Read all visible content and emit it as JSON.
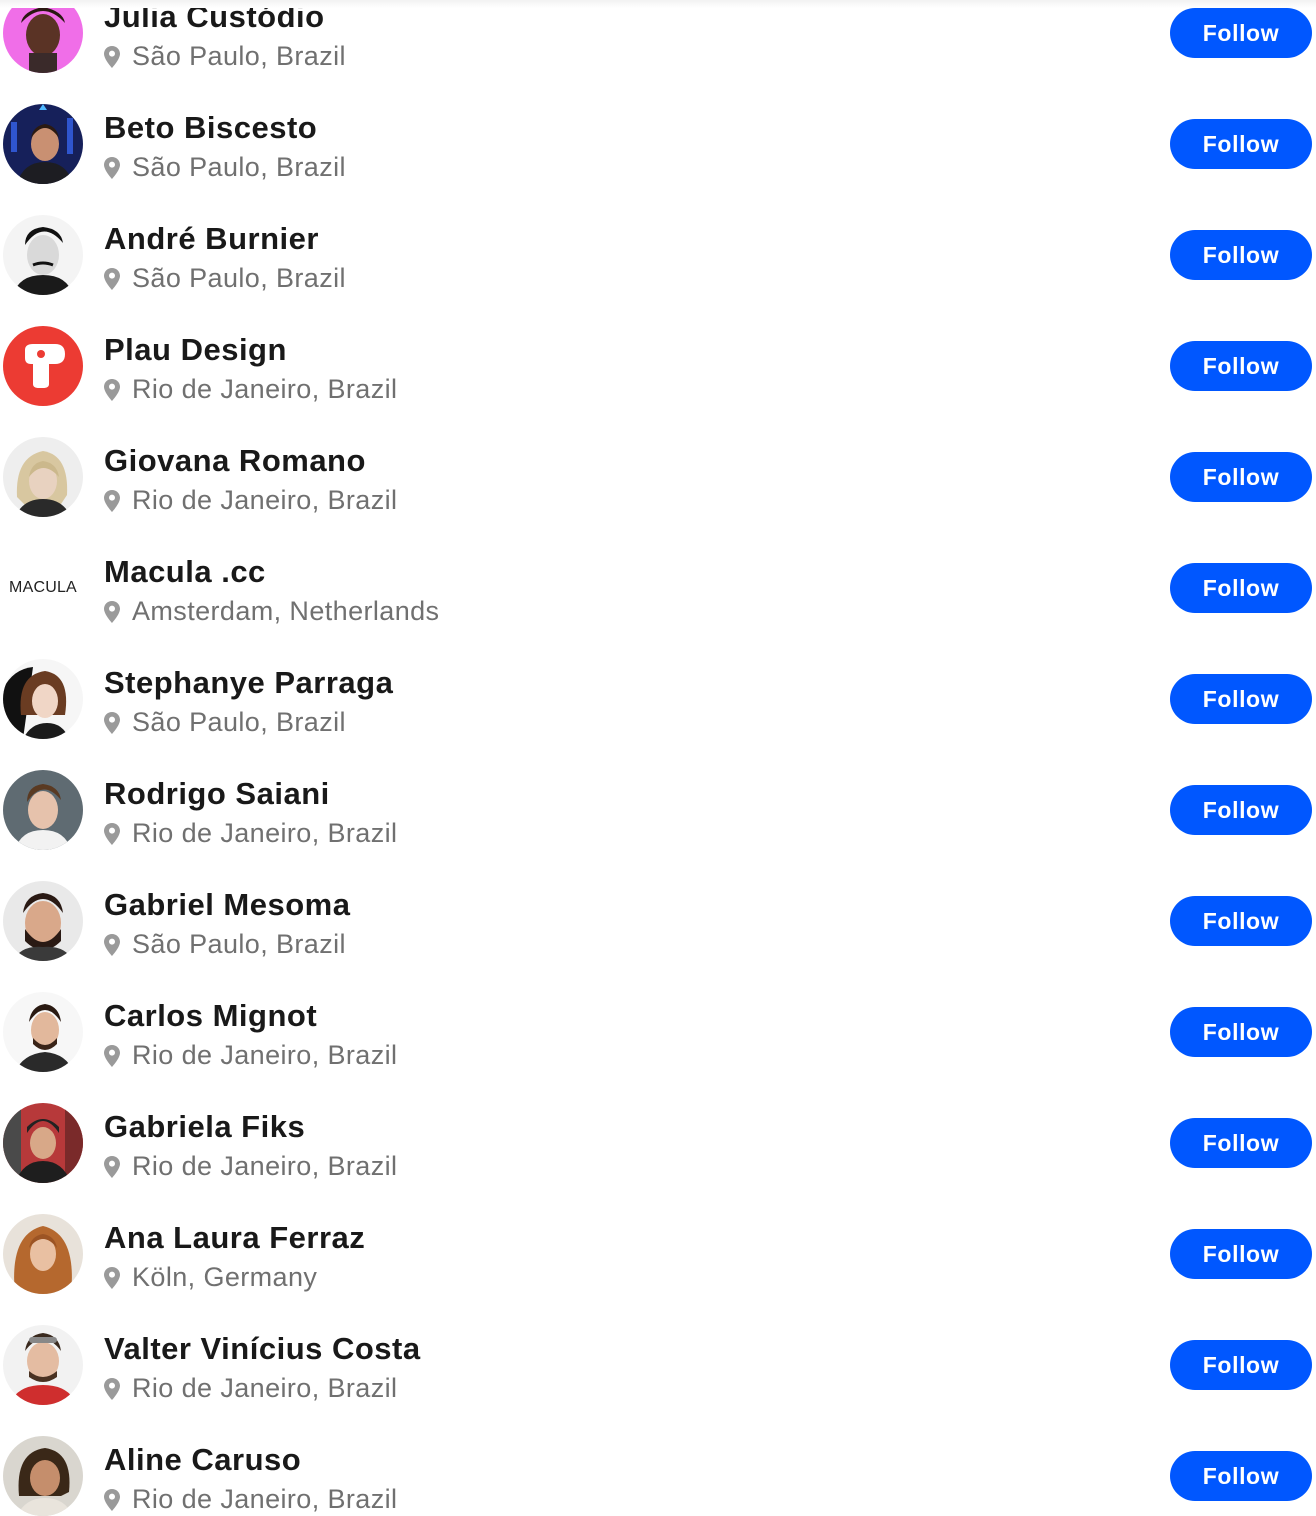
{
  "accent_color": "#0057ff",
  "follow_label": "Follow",
  "location_icon": "map-pin-icon",
  "people": [
    {
      "name": "Julia Custódio",
      "location": "São Paulo, Brazil"
    },
    {
      "name": "Beto Biscesto",
      "location": "São Paulo, Brazil"
    },
    {
      "name": "André Burnier",
      "location": "São Paulo, Brazil"
    },
    {
      "name": "Plau Design",
      "location": "Rio de Janeiro, Brazil"
    },
    {
      "name": "Giovana Romano",
      "location": "Rio de Janeiro, Brazil"
    },
    {
      "name": "Macula .cc",
      "location": "Amsterdam, Netherlands",
      "avatar_text": "MACULA"
    },
    {
      "name": "Stephanye Parraga",
      "location": "São Paulo, Brazil"
    },
    {
      "name": "Rodrigo Saiani",
      "location": "Rio de Janeiro, Brazil"
    },
    {
      "name": "Gabriel Mesoma",
      "location": "São Paulo, Brazil"
    },
    {
      "name": "Carlos Mignot",
      "location": "Rio de Janeiro, Brazil"
    },
    {
      "name": "Gabriela Fiks",
      "location": "Rio de Janeiro, Brazil"
    },
    {
      "name": "Ana Laura Ferraz",
      "location": "Köln, Germany"
    },
    {
      "name": "Valter Vinícius Costa",
      "location": "Rio de Janeiro, Brazil"
    },
    {
      "name": "Aline Caruso",
      "location": "Rio de Janeiro, Brazil"
    }
  ]
}
